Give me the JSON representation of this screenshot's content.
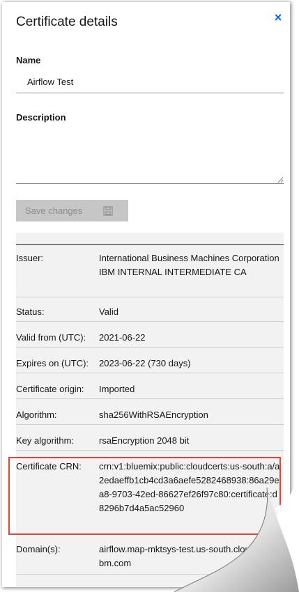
{
  "panel": {
    "title": "Certificate details",
    "close_icon": "close-icon"
  },
  "form": {
    "name_label": "Name",
    "name_value": "Airflow Test",
    "description_label": "Description",
    "description_value": "",
    "save_label": "Save changes",
    "save_icon": "save-icon"
  },
  "details": [
    {
      "key": "Issuer:",
      "value": "International Business Machines Corporation IBM INTERNAL INTERMEDIATE CA"
    },
    {
      "key": "Status:",
      "value": "Valid"
    },
    {
      "key": "Valid from (UTC):",
      "value": "2021-06-22"
    },
    {
      "key": "Expires on (UTC):",
      "value": "2023-06-22 (730 days)"
    },
    {
      "key": "Certificate origin:",
      "value": "Imported"
    },
    {
      "key": "Algorithm:",
      "value": "sha256WithRSAEncryption"
    },
    {
      "key": "Key algorithm:",
      "value": "rsaEncryption 2048 bit"
    },
    {
      "key": "Certificate CRN:",
      "value": "crn:v1:bluemix:public:cloudcerts:us-south:a/a2edaeffb1cb4cd3a6aefe5282468938:86a29ea8-9703-42ed-86627ef26f97c80:certificate:d8296b7d4a5ac52960"
    },
    {
      "key": "Domain(s):",
      "value": "airflow.map-mktsys-test.us-south.cloud.use.ibm.com"
    }
  ],
  "colors": {
    "accent": "#0f62fe",
    "highlight": "#e0453a",
    "disabled_button": "#c6c6c6"
  }
}
